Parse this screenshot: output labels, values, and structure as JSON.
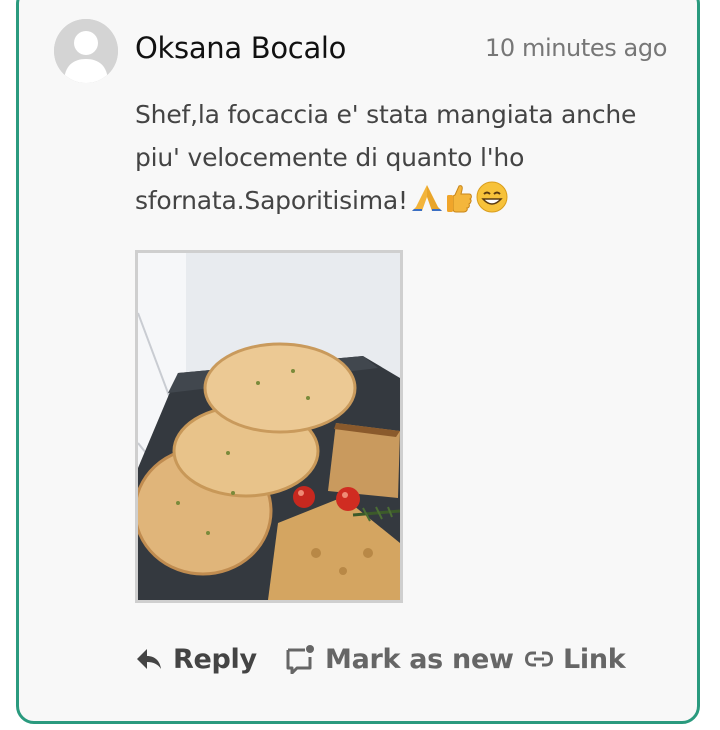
{
  "comment": {
    "author": "Oksana Bocalo",
    "timestamp": "10 minutes ago",
    "text": "Shef,la focaccia e' stata mangiata anche piu' velocemente di quanto l'ho sfornata.Saporitisima!",
    "emojis": [
      "folded-hands",
      "thumbs-up",
      "grinning-face"
    ],
    "attachment_icon": "focaccia-photo"
  },
  "actions": {
    "reply_label": "Reply",
    "mark_new_label": "Mark as new",
    "link_label": "Link"
  },
  "colors": {
    "border": "#2a9a7e",
    "card_background": "#f8f8f8",
    "text": "#444444",
    "muted": "#777777"
  }
}
